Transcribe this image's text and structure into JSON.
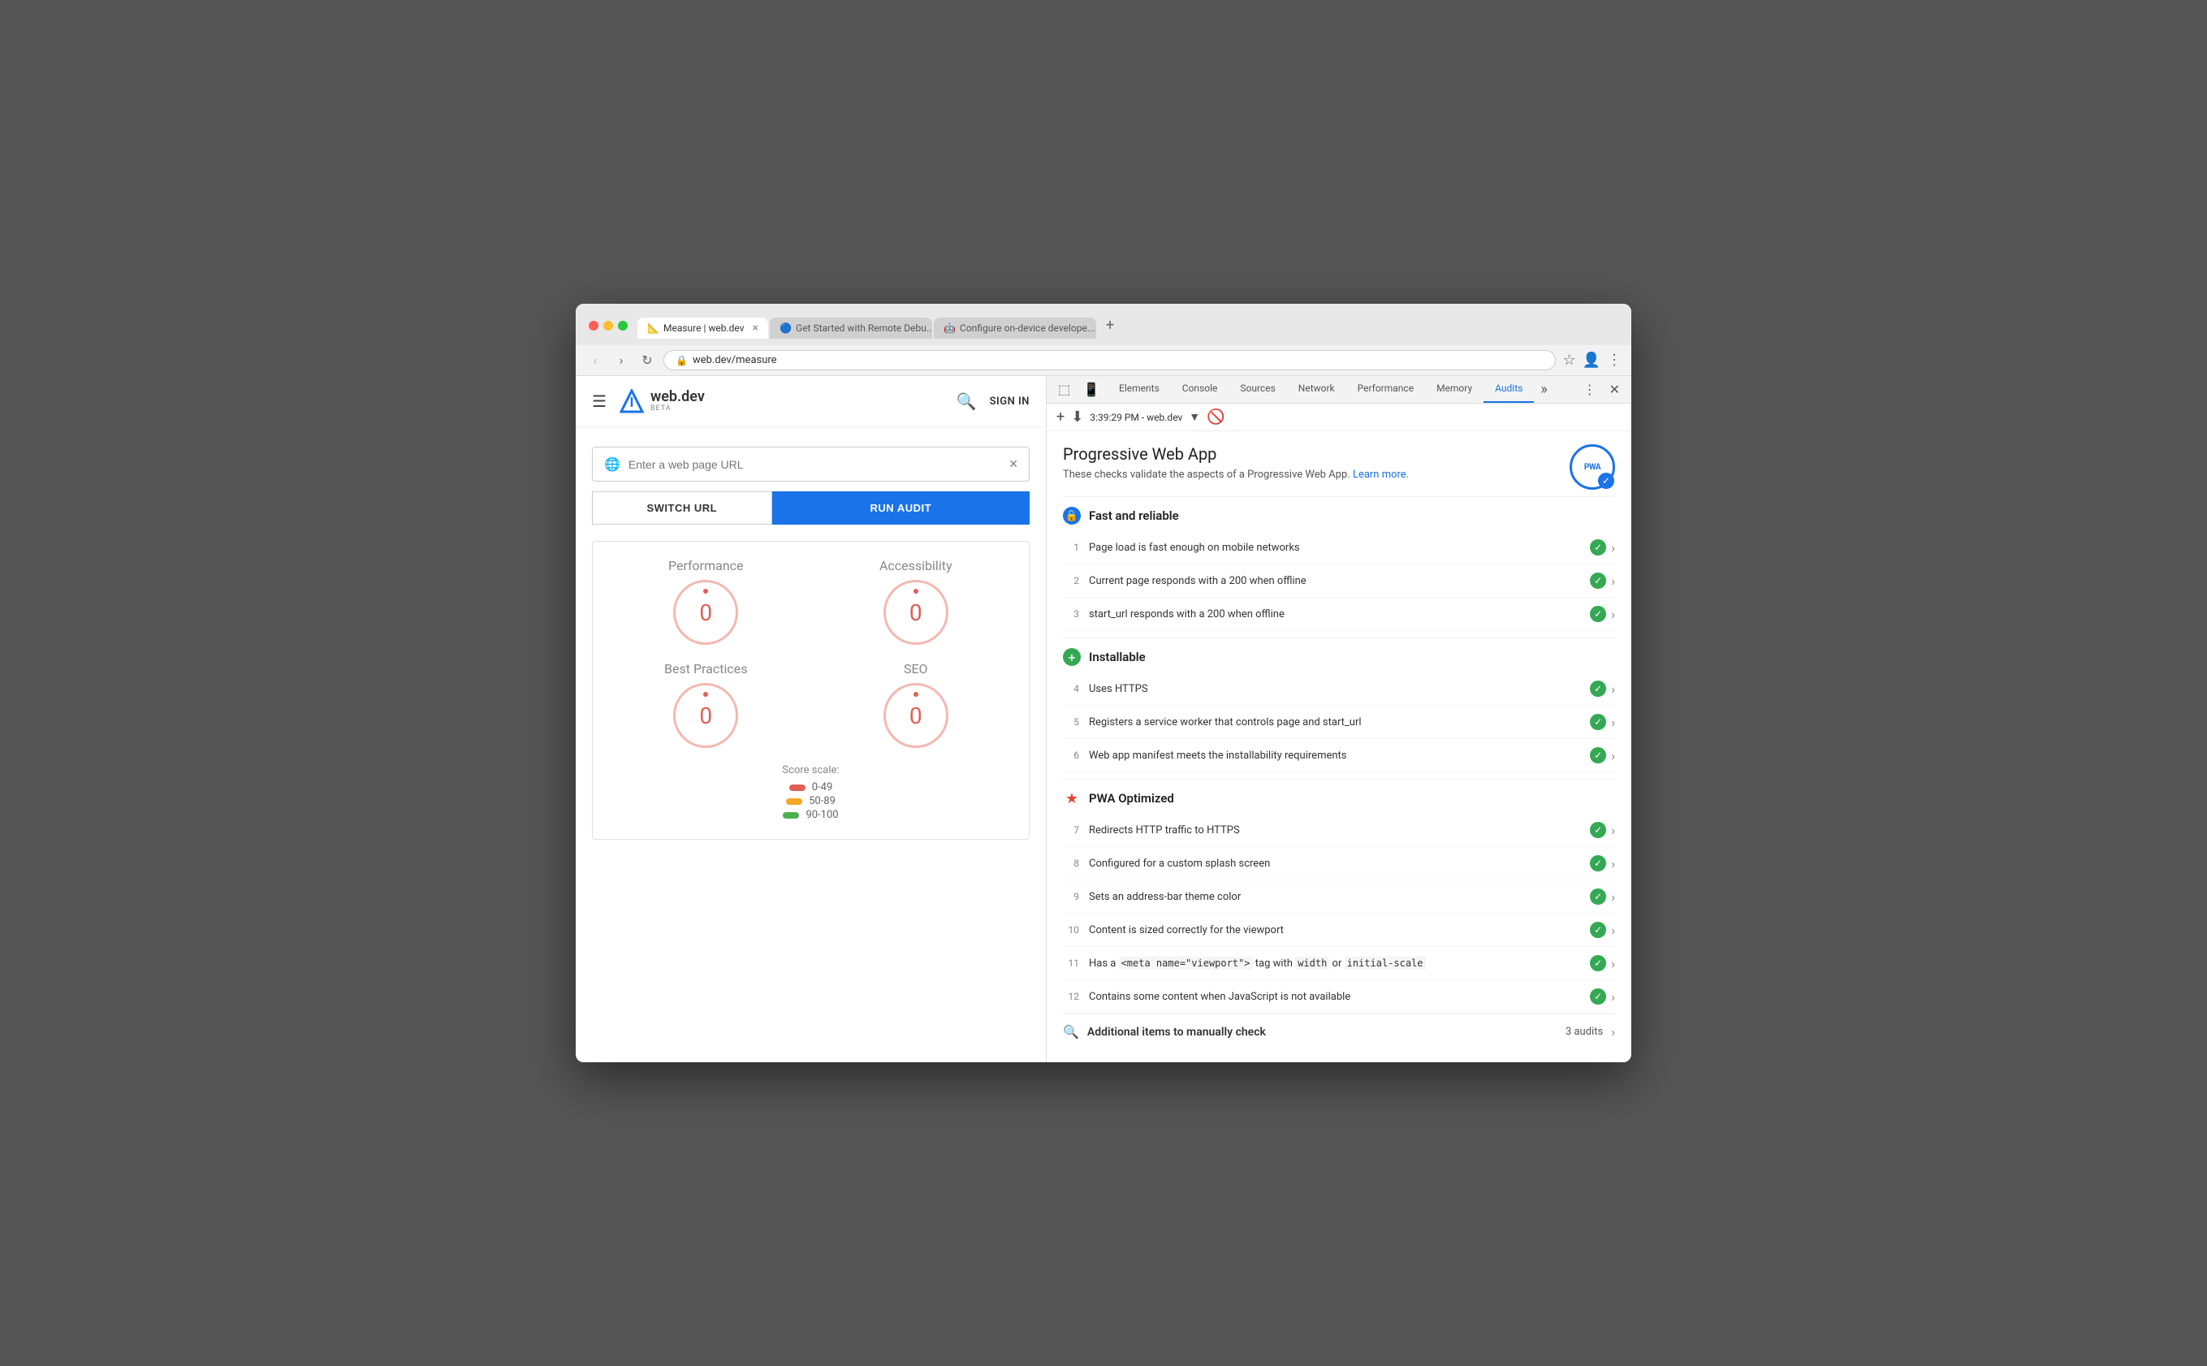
{
  "browser": {
    "tabs": [
      {
        "id": "tab1",
        "favicon": "📐",
        "title": "Measure | web.dev",
        "active": true
      },
      {
        "id": "tab2",
        "favicon": "🔵",
        "title": "Get Started with Remote Debu...",
        "active": false
      },
      {
        "id": "tab3",
        "favicon": "🤖",
        "title": "Configure on-device develope...",
        "active": false
      }
    ],
    "address": "web.dev/measure",
    "new_tab_label": "+"
  },
  "webdev": {
    "logo_text": "web.dev",
    "logo_beta": "BETA",
    "sign_in_label": "SIGN IN",
    "url_placeholder": "Enter a web page URL",
    "switch_url_label": "SWITCH URL",
    "run_audit_label": "RUN AUDIT",
    "scores": [
      {
        "label": "Performance",
        "value": "0"
      },
      {
        "label": "Accessibility",
        "value": "0"
      },
      {
        "label": "Best Practices",
        "value": "0"
      },
      {
        "label": "SEO",
        "value": "0"
      }
    ],
    "score_scale_title": "Score scale:",
    "scale": [
      {
        "range": "0-49",
        "color": "red"
      },
      {
        "range": "50-89",
        "color": "yellow"
      },
      {
        "range": "90-100",
        "color": "green"
      }
    ]
  },
  "devtools": {
    "tabs": [
      {
        "label": "Elements",
        "active": false
      },
      {
        "label": "Console",
        "active": false
      },
      {
        "label": "Sources",
        "active": false
      },
      {
        "label": "Network",
        "active": false
      },
      {
        "label": "Performance",
        "active": false
      },
      {
        "label": "Memory",
        "active": false
      },
      {
        "label": "Audits",
        "active": true
      }
    ],
    "timestamp": "3:39:29 PM - web.dev",
    "audit_panel": {
      "title": "Progressive Web App",
      "description": "These checks validate the aspects of a Progressive Web App.",
      "learn_more": "Learn more.",
      "pwa_badge": "PWA",
      "sections": [
        {
          "id": "fast-reliable",
          "icon_type": "blue",
          "icon_symbol": "🔒",
          "title": "Fast and reliable",
          "items": [
            {
              "num": 1,
              "text": "Page load is fast enough on mobile networks"
            },
            {
              "num": 2,
              "text": "Current page responds with a 200 when offline"
            },
            {
              "num": 3,
              "text": "start_url responds with a 200 when offline"
            }
          ]
        },
        {
          "id": "installable",
          "icon_type": "green-plus",
          "icon_symbol": "+",
          "title": "Installable",
          "items": [
            {
              "num": 4,
              "text": "Uses HTTPS"
            },
            {
              "num": 5,
              "text": "Registers a service worker that controls page and start_url"
            },
            {
              "num": 6,
              "text": "Web app manifest meets the installability requirements"
            }
          ]
        },
        {
          "id": "pwa-optimized",
          "icon_type": "star",
          "icon_symbol": "★",
          "title": "PWA Optimized",
          "items": [
            {
              "num": 7,
              "text": "Redirects HTTP traffic to HTTPS"
            },
            {
              "num": 8,
              "text": "Configured for a custom splash screen"
            },
            {
              "num": 9,
              "text": "Sets an address-bar theme color"
            },
            {
              "num": 10,
              "text": "Content is sized correctly for the viewport"
            },
            {
              "num": 11,
              "text": "Has a <meta name=\"viewport\"> tag with width or initial-scale",
              "has_code": true,
              "code_parts": [
                "<meta name=\"viewport\">",
                "width",
                "initial-scale"
              ]
            },
            {
              "num": 12,
              "text": "Contains some content when JavaScript is not available"
            }
          ]
        }
      ],
      "additional_items_label": "Additional items to manually check",
      "additional_items_count": "3 audits"
    }
  }
}
